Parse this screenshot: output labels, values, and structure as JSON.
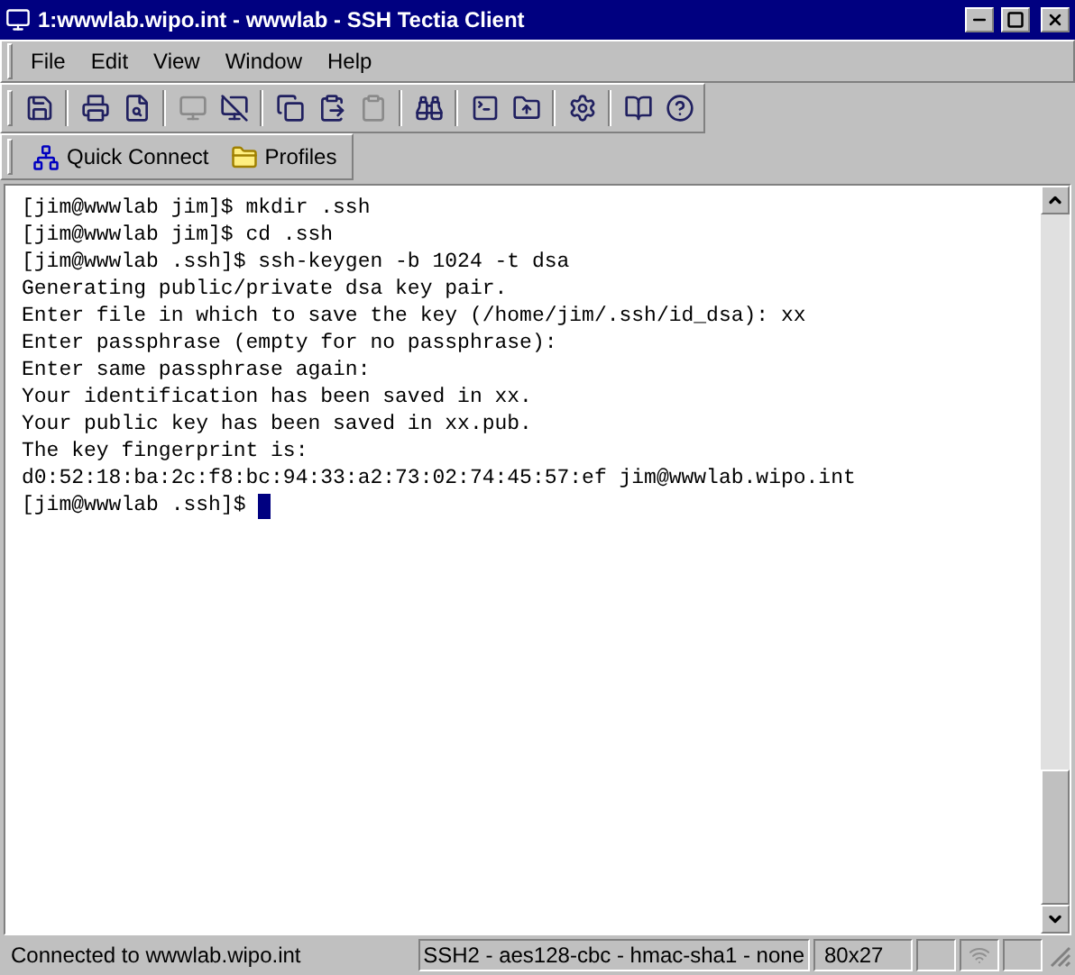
{
  "window": {
    "title": "1:wwwlab.wipo.int - wwwlab - SSH Tectia Client"
  },
  "menu": [
    "File",
    "Edit",
    "View",
    "Window",
    "Help"
  ],
  "toolbar": [
    [
      {
        "disabled": false
      }
    ],
    [
      {
        "disabled": false
      },
      {
        "disabled": false
      }
    ],
    [
      {
        "disabled": true
      },
      {
        "disabled": false
      }
    ],
    [
      {
        "disabled": false
      },
      {
        "disabled": false
      },
      {
        "disabled": true
      }
    ],
    [
      {
        "disabled": false
      }
    ],
    [
      {
        "disabled": false
      },
      {
        "disabled": false
      }
    ],
    [
      {
        "disabled": false
      }
    ],
    [
      {
        "disabled": false
      },
      {
        "disabled": false
      }
    ]
  ],
  "profile_bar": [
    {
      "kind": "connect",
      "label": "Quick Connect"
    },
    {
      "kind": "folder",
      "label": "Profiles"
    }
  ],
  "terminal": {
    "lines": [
      "[jim@wwwlab jim]$ mkdir .ssh",
      "[jim@wwwlab jim]$ cd .ssh",
      "[jim@wwwlab .ssh]$ ssh-keygen -b 1024 -t dsa",
      "Generating public/private dsa key pair.",
      "Enter file in which to save the key (/home/jim/.ssh/id_dsa): xx",
      "Enter passphrase (empty for no passphrase):",
      "Enter same passphrase again:",
      "Your identification has been saved in xx.",
      "Your public key has been saved in xx.pub.",
      "The key fingerprint is:",
      "d0:52:18:ba:2c:f8:bc:94:33:a2:73:02:74:45:57:ef jim@wwwlab.wipo.int"
    ],
    "prompt": "[jim@wwwlab .ssh]$"
  },
  "status_bar": {
    "message": "Connected to wwwlab.wipo.int",
    "cipher": "SSH2 - aes128-cbc - hmac-sha1 - none",
    "size": "80x27"
  }
}
